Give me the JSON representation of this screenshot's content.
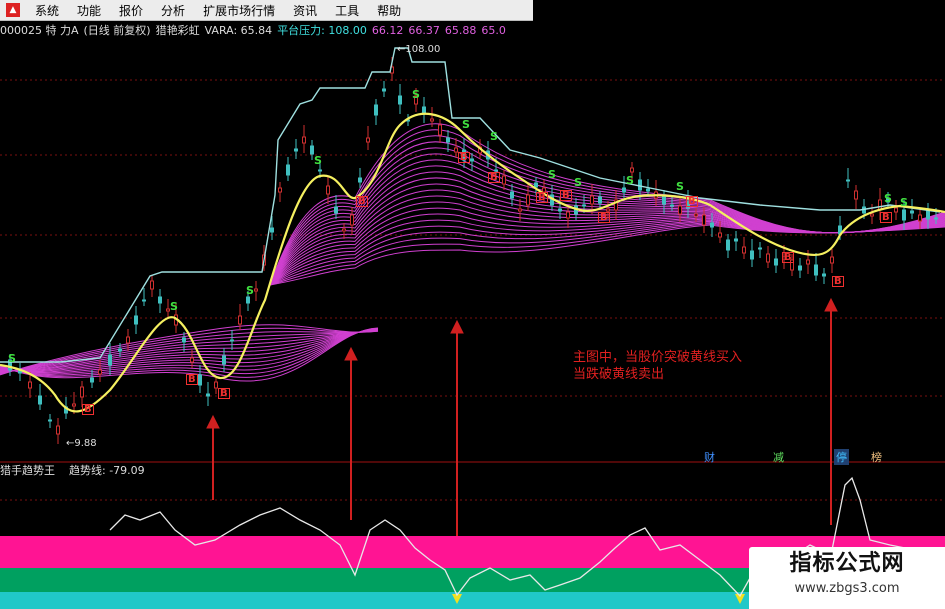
{
  "menu": {
    "icon": "app-logo-icon",
    "items": [
      "系统",
      "功能",
      "报价",
      "分析",
      "扩展市场行情",
      "资讯",
      "工具",
      "帮助"
    ]
  },
  "infobar": {
    "code_name": "000025 特 力A",
    "period": "(日线 前复权)",
    "indicator": "猎艳彩虹",
    "vara": "VARA: 65.84",
    "platform_label": "平台压力: 108.00",
    "values": [
      "66.12",
      "66.37",
      "65.88",
      "65.0"
    ]
  },
  "price_labels": {
    "high": "108.00",
    "low": "9.88"
  },
  "signals": {
    "sell": "S",
    "buy": "B"
  },
  "annotation": {
    "line1": "主图中，当股价突破黄线买入",
    "line2": "当跌破黄线卖出"
  },
  "tags": [
    "财",
    "减",
    "停",
    "榜"
  ],
  "sub_indicator": {
    "name": "猎手趋势王",
    "value": "趋势线: -79.09"
  },
  "watermark": {
    "main": "指标公式网",
    "sub": "www.zbgs3.com"
  },
  "colors": {
    "rainbow": "#d040d0",
    "yellow_line": "#f5f060",
    "platform_line": "#9fe0e0",
    "arrow": "#d02020",
    "band_pink": "#ff1493",
    "band_green": "#00a060",
    "band_cyan": "#20c8c8"
  }
}
